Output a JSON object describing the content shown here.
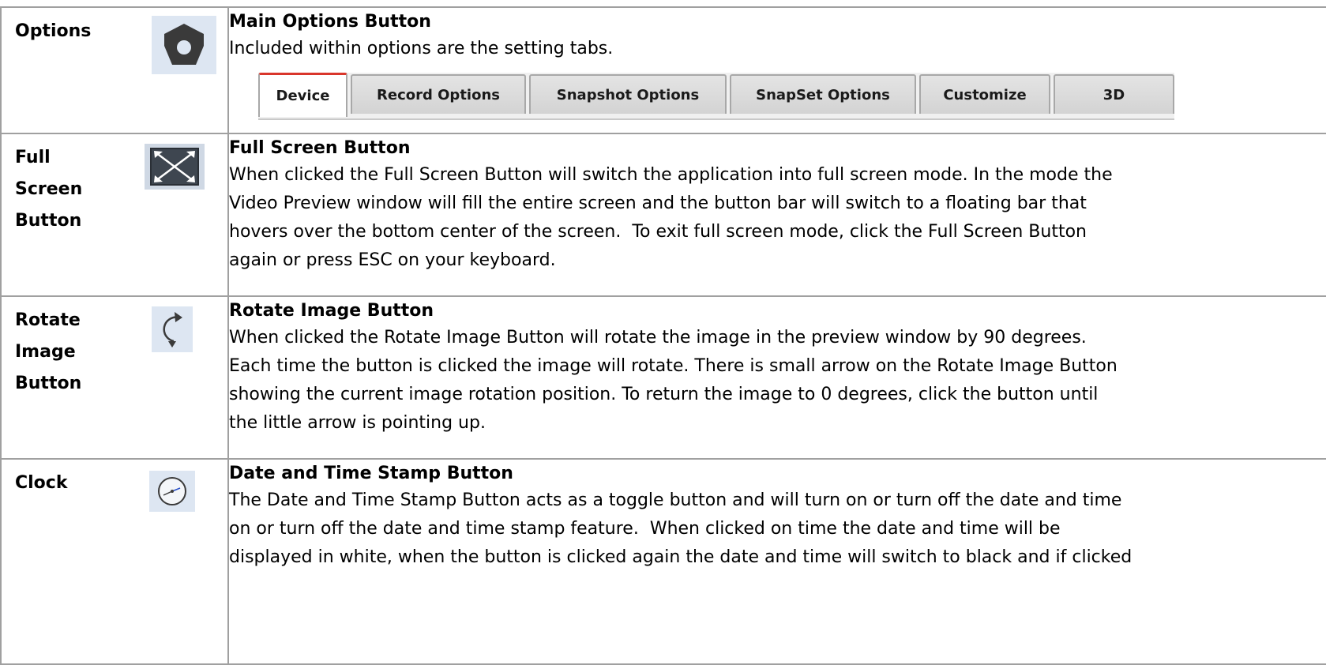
{
  "rows": [
    {
      "label": "Options",
      "icon": "options-gear-icon",
      "title": "Main Options Button",
      "body": "Included within options are the setting tabs.",
      "tabs": [
        {
          "label": "Device",
          "active": true
        },
        {
          "label": "Record Options",
          "active": false
        },
        {
          "label": "Snapshot Options",
          "active": false
        },
        {
          "label": "SnapSet Options",
          "active": false
        },
        {
          "label": "Customize",
          "active": false
        },
        {
          "label": "3D",
          "active": false
        }
      ]
    },
    {
      "label": "Full\nScreen\nButton",
      "icon": "fullscreen-icon",
      "title": "Full Screen Button",
      "body": "When clicked the Full Screen Button will switch the application into full screen mode. In the mode the\nVideo Preview window will fill the entire screen and the button bar will switch to a floating bar that\nhovers over the bottom center of the screen.  To exit full screen mode, click the Full Screen Button\nagain or press ESC on your keyboard."
    },
    {
      "label": "Rotate\nImage\nButton",
      "icon": "rotate-icon",
      "title": "Rotate Image Button",
      "body": "When clicked the Rotate Image Button will rotate the image in the preview window by 90 degrees.\nEach time the button is clicked the image will rotate. There is small arrow on the Rotate Image Button\nshowing the current image rotation position. To return the image to 0 degrees, click the button until\nthe little arrow is pointing up."
    },
    {
      "label": "Clock",
      "icon": "clock-icon",
      "title": "Date and Time Stamp Button",
      "body": "The Date and Time Stamp Button acts as a toggle button and will turn on or turn off the date and time\non or turn off the date and time stamp feature.  When clicked on time the date and time will be\ndisplayed in white, when the button is clicked again the date and time will switch to black and if clicked"
    }
  ]
}
